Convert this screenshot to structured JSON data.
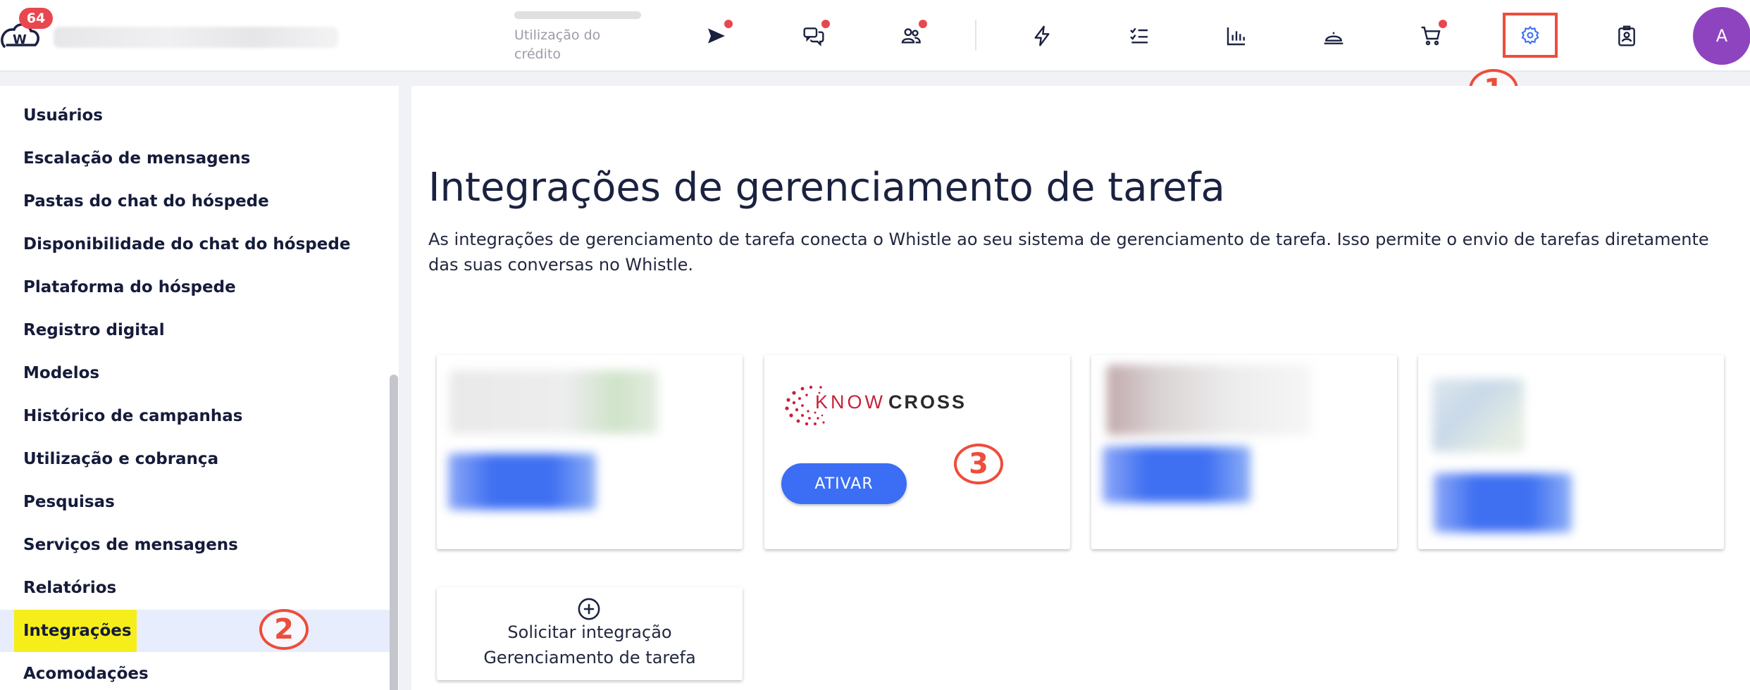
{
  "header": {
    "notification_count": "64",
    "credit_label": "Utilização do crédito",
    "avatar_initial": "A"
  },
  "callouts": [
    "1",
    "2",
    "3"
  ],
  "sidebar": {
    "items": [
      {
        "label": "Usuários"
      },
      {
        "label": "Escalação de mensagens"
      },
      {
        "label": "Pastas do chat do hóspede"
      },
      {
        "label": "Disponibilidade do chat do hóspede"
      },
      {
        "label": "Plataforma do hóspede"
      },
      {
        "label": "Registro digital"
      },
      {
        "label": "Modelos"
      },
      {
        "label": "Histórico de campanhas"
      },
      {
        "label": "Utilização e cobrança"
      },
      {
        "label": "Pesquisas"
      },
      {
        "label": "Serviços de mensagens"
      },
      {
        "label": "Relatórios"
      },
      {
        "label": "Integrações",
        "active": true
      },
      {
        "label": "Acomodações"
      }
    ]
  },
  "main": {
    "title": "Integrações de gerenciamento de tarefa",
    "description": "As integrações de gerenciamento de tarefa conecta o Whistle ao seu sistema de gerenciamento de tarefa. Isso permite o envio de tarefas diretamente das suas conversas no Whistle.",
    "knowcross": {
      "logo_text_red": "KNOW",
      "logo_text_dark": "CROSS",
      "button": "ATIVAR"
    },
    "request": {
      "line1": "Solicitar integração",
      "line2": "Gerenciamento de tarefa"
    }
  },
  "colors": {
    "accent": "#3b6ef5",
    "alert": "#e8474f",
    "annotation": "#ee4d3b",
    "avatar": "#8f44bf",
    "highlight": "#f5ee1a"
  }
}
